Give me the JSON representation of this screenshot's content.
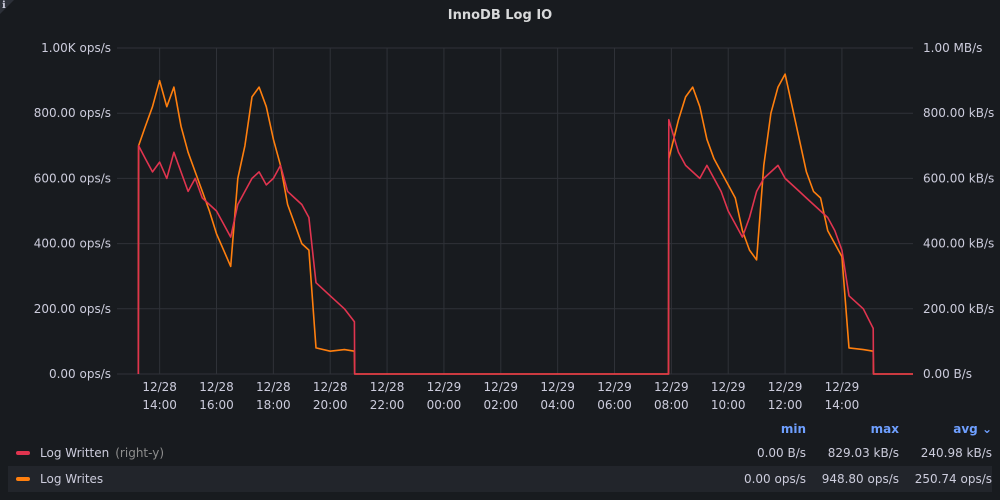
{
  "panel": {
    "title": "InnoDB Log IO",
    "info_icon": "info-icon"
  },
  "colors": {
    "background": "#181b1f",
    "grid": "#2f3238",
    "log_written": "#e0344f",
    "log_writes": "#ff7f0e"
  },
  "legend": {
    "columns": {
      "min": "min",
      "max": "max",
      "avg": "avg ⌄"
    },
    "rows": [
      {
        "name": "Log Written",
        "axis_note": "(right-y)",
        "color": "#e0344f",
        "min": "0.00 B/s",
        "max": "829.03 kB/s",
        "avg": "240.98 kB/s"
      },
      {
        "name": "Log Writes",
        "axis_note": "",
        "color": "#ff7f0e",
        "min": "0.00 ops/s",
        "max": "948.80 ops/s",
        "avg": "250.74 ops/s"
      }
    ]
  },
  "chart_data": {
    "type": "line",
    "title": "InnoDB Log IO",
    "grid": true,
    "legend_position": "bottom",
    "x_ticks": [
      [
        "12/28",
        "14:00"
      ],
      [
        "12/28",
        "16:00"
      ],
      [
        "12/28",
        "18:00"
      ],
      [
        "12/28",
        "20:00"
      ],
      [
        "12/28",
        "22:00"
      ],
      [
        "12/29",
        "00:00"
      ],
      [
        "12/29",
        "02:00"
      ],
      [
        "12/29",
        "04:00"
      ],
      [
        "12/29",
        "06:00"
      ],
      [
        "12/29",
        "08:00"
      ],
      [
        "12/29",
        "10:00"
      ],
      [
        "12/29",
        "12:00"
      ],
      [
        "12/29",
        "14:00"
      ]
    ],
    "x_range_hours": [
      -1.5,
      26.5
    ],
    "y_left": {
      "unit": "ops/s",
      "ylim": [
        0,
        1000
      ],
      "ticks": [
        "0.00 ops/s",
        "200.00 ops/s",
        "400.00 ops/s",
        "600.00 ops/s",
        "800.00 ops/s",
        "1.00K ops/s"
      ]
    },
    "y_right": {
      "unit": "B/s",
      "ylim": [
        0,
        1000
      ],
      "ticks": [
        "0.00 B/s",
        "200.00 kB/s",
        "400.00 kB/s",
        "600.00 kB/s",
        "800.00 kB/s",
        "1.00 MB/s"
      ]
    },
    "series": [
      {
        "name": "Log Writes",
        "axis": "left",
        "color": "#ff7f0e",
        "points": [
          [
            -0.75,
            0
          ],
          [
            -0.74,
            700
          ],
          [
            -0.5,
            760
          ],
          [
            -0.25,
            820
          ],
          [
            0,
            900
          ],
          [
            0.25,
            820
          ],
          [
            0.5,
            880
          ],
          [
            0.75,
            760
          ],
          [
            1,
            680
          ],
          [
            1.25,
            620
          ],
          [
            1.5,
            560
          ],
          [
            1.75,
            500
          ],
          [
            2,
            430
          ],
          [
            2.25,
            380
          ],
          [
            2.5,
            330
          ],
          [
            2.75,
            600
          ],
          [
            3,
            700
          ],
          [
            3.25,
            850
          ],
          [
            3.5,
            880
          ],
          [
            3.75,
            820
          ],
          [
            4,
            720
          ],
          [
            4.25,
            640
          ],
          [
            4.5,
            520
          ],
          [
            4.75,
            460
          ],
          [
            5,
            400
          ],
          [
            5.25,
            380
          ],
          [
            5.5,
            80
          ],
          [
            6,
            70
          ],
          [
            6.5,
            75
          ],
          [
            6.85,
            70
          ],
          [
            6.86,
            0
          ],
          [
            17.9,
            0
          ],
          [
            17.91,
            660
          ],
          [
            18.25,
            780
          ],
          [
            18.5,
            850
          ],
          [
            18.75,
            880
          ],
          [
            19,
            820
          ],
          [
            19.25,
            720
          ],
          [
            19.5,
            660
          ],
          [
            19.75,
            620
          ],
          [
            20,
            580
          ],
          [
            20.25,
            540
          ],
          [
            20.5,
            440
          ],
          [
            20.75,
            380
          ],
          [
            21,
            350
          ],
          [
            21.25,
            640
          ],
          [
            21.5,
            800
          ],
          [
            21.75,
            880
          ],
          [
            22,
            920
          ],
          [
            22.25,
            820
          ],
          [
            22.5,
            720
          ],
          [
            22.75,
            620
          ],
          [
            23,
            560
          ],
          [
            23.25,
            540
          ],
          [
            23.5,
            440
          ],
          [
            23.75,
            400
          ],
          [
            24,
            360
          ],
          [
            24.25,
            80
          ],
          [
            24.75,
            75
          ],
          [
            25.1,
            70
          ],
          [
            25.11,
            0
          ],
          [
            26.5,
            0
          ]
        ]
      },
      {
        "name": "Log Written",
        "axis": "right",
        "color": "#e0344f",
        "points": [
          [
            -0.75,
            0
          ],
          [
            -0.74,
            700
          ],
          [
            -0.5,
            660
          ],
          [
            -0.25,
            620
          ],
          [
            0,
            650
          ],
          [
            0.25,
            600
          ],
          [
            0.5,
            680
          ],
          [
            0.75,
            620
          ],
          [
            1,
            560
          ],
          [
            1.25,
            600
          ],
          [
            1.5,
            540
          ],
          [
            1.75,
            520
          ],
          [
            2,
            500
          ],
          [
            2.25,
            460
          ],
          [
            2.5,
            420
          ],
          [
            2.75,
            520
          ],
          [
            3,
            560
          ],
          [
            3.25,
            600
          ],
          [
            3.5,
            620
          ],
          [
            3.75,
            580
          ],
          [
            4,
            600
          ],
          [
            4.25,
            640
          ],
          [
            4.5,
            560
          ],
          [
            4.75,
            540
          ],
          [
            5,
            520
          ],
          [
            5.25,
            480
          ],
          [
            5.5,
            280
          ],
          [
            6,
            240
          ],
          [
            6.5,
            200
          ],
          [
            6.85,
            160
          ],
          [
            6.86,
            0
          ],
          [
            17.9,
            0
          ],
          [
            17.91,
            780
          ],
          [
            18.25,
            680
          ],
          [
            18.5,
            640
          ],
          [
            18.75,
            620
          ],
          [
            19,
            600
          ],
          [
            19.25,
            640
          ],
          [
            19.5,
            600
          ],
          [
            19.75,
            560
          ],
          [
            20,
            500
          ],
          [
            20.25,
            460
          ],
          [
            20.5,
            420
          ],
          [
            20.75,
            480
          ],
          [
            21,
            560
          ],
          [
            21.25,
            600
          ],
          [
            21.5,
            620
          ],
          [
            21.75,
            640
          ],
          [
            22,
            600
          ],
          [
            22.25,
            580
          ],
          [
            22.5,
            560
          ],
          [
            22.75,
            540
          ],
          [
            23,
            520
          ],
          [
            23.25,
            500
          ],
          [
            23.5,
            480
          ],
          [
            23.75,
            440
          ],
          [
            24,
            380
          ],
          [
            24.25,
            240
          ],
          [
            24.75,
            200
          ],
          [
            25.1,
            140
          ],
          [
            25.11,
            0
          ],
          [
            26.5,
            0
          ]
        ]
      }
    ]
  }
}
